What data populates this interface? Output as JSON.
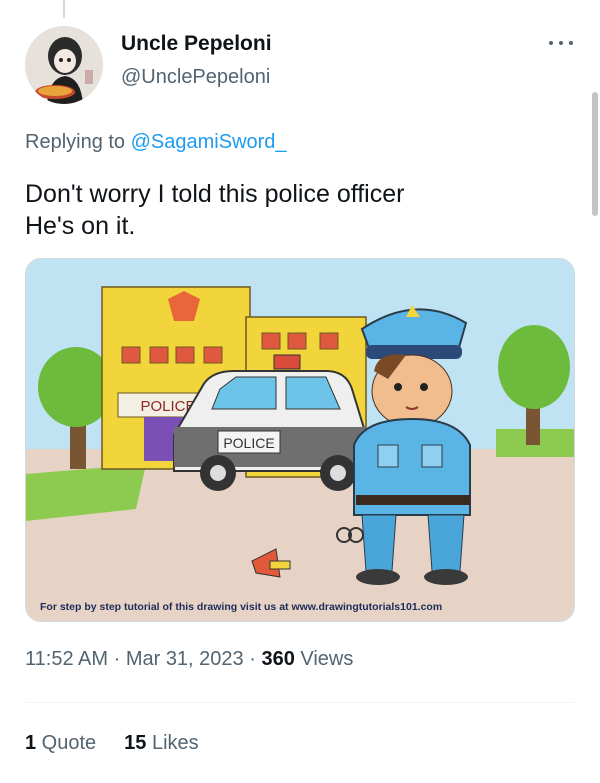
{
  "author": {
    "name": "Uncle Pepeloni",
    "handle": "@UnclePepeloni",
    "avatar_icon": "profile-avatar"
  },
  "more_icon": "more-icon",
  "reply": {
    "prefix": "Replying to ",
    "target": "@SagamiSword_"
  },
  "tweet": {
    "line1": "Don't worry I told this police officer",
    "line2": "He's on it."
  },
  "media": {
    "police_sign": "POLICE",
    "car_label": "POLICE",
    "caption": "For step by step tutorial of this drawing visit us at www.drawingtutorials101.com"
  },
  "meta": {
    "time": "11:52 AM",
    "sep1": " · ",
    "date": "Mar 31, 2023",
    "sep2": " · ",
    "views_count": "360",
    "views_label": " Views"
  },
  "stats": {
    "quotes_count": "1",
    "quotes_label": " Quote",
    "likes_count": "15",
    "likes_label": " Likes"
  },
  "colors": {
    "link": "#1d9bf0",
    "secondary_text": "#536471",
    "primary_text": "#0f1419"
  }
}
